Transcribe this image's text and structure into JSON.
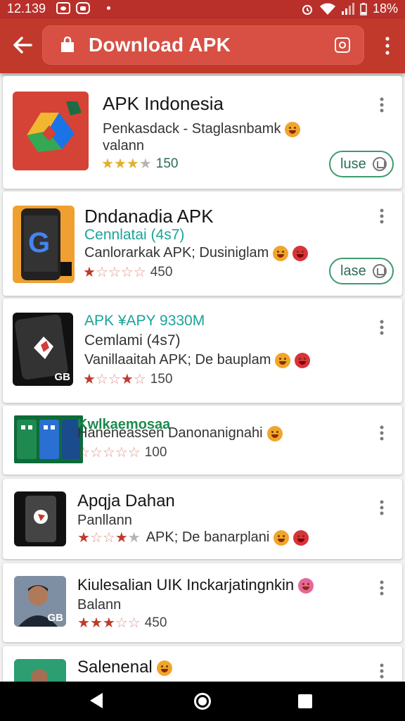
{
  "status_bar": {
    "time": "12.139",
    "battery": "18%",
    "icons": [
      "message-icon",
      "app-icon",
      "alarm-icon",
      "wifi-icon",
      "signal-icon",
      "battery-icon"
    ]
  },
  "app_bar": {
    "title": "Download APK",
    "colors": {
      "bar": "#c0392b",
      "pill": "#d75043"
    }
  },
  "items": [
    {
      "title": "APK Indonesia",
      "line1": "Penkasdack - Staglasnbamk",
      "line2": "valann",
      "rating_count": "150",
      "action_label": "luse"
    },
    {
      "title": "Dndanadia APK",
      "line1": "Cennlatai (4s7)",
      "line2": "Canlorarkak APK; Dusiniglam",
      "rating_count": "450",
      "action_label": "lase"
    },
    {
      "title": "APK ¥APY 9330M",
      "line1": "Cemlami (4s7)",
      "line2": "Vanillaaitah APK; De bauplam",
      "rating_count": "150",
      "thumb_badge": "GB"
    },
    {
      "title": "Kwlkaemosaa",
      "line1": "Haneneassen Danonanignahi",
      "rating_count": "100"
    },
    {
      "title": "Apqja Dahan",
      "line1": "Panllann",
      "line2": "APK; De banarplani"
    },
    {
      "title": "Kiulesalian UIK Inckarjatingnkin",
      "line1": "Balann",
      "rating_count": "450",
      "thumb_badge": "GB"
    },
    {
      "title": "Salenenal"
    }
  ]
}
